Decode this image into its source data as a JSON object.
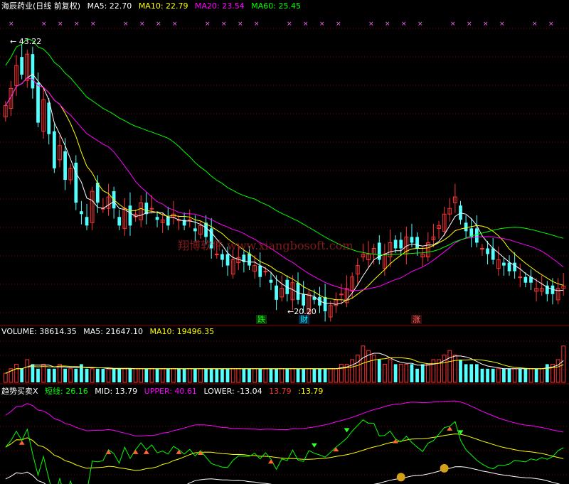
{
  "price_panel": {
    "stock": "海辰药业(日线 前复权)",
    "ma_labels": [
      {
        "label": "MA5: 22.70",
        "color": "#ffffff"
      },
      {
        "label": "MA10: 22.79",
        "color": "#ffff00"
      },
      {
        "label": "MA20: 23.54",
        "color": "#ff00ff"
      },
      {
        "label": "MA60: 25.45",
        "color": "#00ff00"
      }
    ],
    "high_note": "← 43.22",
    "low_note": "←20.20",
    "badges": [
      {
        "text": "跌",
        "color": "#00ff00",
        "bg": "#0c3a0c"
      },
      {
        "text": "财",
        "color": "#00ffff",
        "bg": "#0a2a4a"
      },
      {
        "text": "涨",
        "color": "#ff6666",
        "bg": "#3a0c0c"
      }
    ],
    "watermark": "翔博软件 www.xiangbosoft.com"
  },
  "volume_panel": {
    "labels": [
      {
        "label": "VOLUME: 38614.35",
        "color": "#ffffff"
      },
      {
        "label": "MA5: 21647.10",
        "color": "#ffffff"
      },
      {
        "label": "MA10: 19496.35",
        "color": "#ffff00"
      }
    ]
  },
  "indicator_panel": {
    "labels": [
      {
        "label": "趋势买卖X",
        "color": "#ffffff"
      },
      {
        "label": "短线: 26.16",
        "color": "#00ff00"
      },
      {
        "label": "MID: 13.79",
        "color": "#ffffff"
      },
      {
        "label": "UPPER: 40.61",
        "color": "#ff00ff"
      },
      {
        "label": "LOWER: -13.04",
        "color": "#ffffff"
      },
      {
        "label": "13.79",
        "color": "#ff3333"
      },
      {
        "label": ":13.79",
        "color": "#ffff00"
      }
    ]
  },
  "colors": {
    "up": "#ff3333",
    "down": "#54ffff",
    "ma5": "#ffffff",
    "ma10": "#ffff00",
    "ma20": "#ff00ff",
    "ma60": "#00ff00",
    "grid": "#8b0000"
  },
  "chart_data": {
    "type": "candlestick",
    "price_axis": {
      "min": 19.5,
      "max": 45.0
    },
    "high_value": 43.22,
    "low_value": 20.2,
    "close_prices": [
      38.5,
      40.0,
      42.0,
      41.2,
      43.0,
      40.0,
      37.0,
      39.0,
      36.0,
      33.0,
      35.0,
      32.0,
      33.0,
      30.0,
      29.0,
      28.0,
      31.0,
      30.0,
      29.5,
      30.5,
      29.5,
      28.0,
      29.5,
      28.0,
      29.0,
      30.0,
      29.0,
      29.5,
      28.5,
      28.5,
      28.0,
      29.0,
      28.5,
      28.0,
      28.5,
      27.5,
      28.0,
      27.0,
      26.0,
      25.5,
      25.0,
      24.5,
      25.0,
      25.2,
      24.8,
      24.5,
      24.5,
      23.5,
      24.0,
      23.0,
      21.5,
      22.5,
      22.0,
      23.0,
      21.5,
      21.0,
      22.0,
      21.5,
      21.0,
      20.5,
      21.0,
      21.5,
      22.0,
      22.5,
      23.5,
      24.5,
      25.5,
      25.5,
      26.0,
      25.0,
      25.5,
      26.5,
      26.0,
      26.0,
      27.0,
      26.5,
      26.0,
      25.5,
      26.5,
      27.0,
      28.0,
      29.0,
      29.5,
      30.5,
      28.5,
      27.5,
      27.0,
      26.5,
      26.0,
      25.5,
      25.0,
      25.0,
      24.5,
      24.0,
      24.0,
      23.5,
      23.0,
      23.0,
      22.5,
      22.5,
      22.0,
      22.0,
      22.5,
      22.7
    ],
    "volume_relative": [
      2,
      3,
      4,
      3,
      5,
      4,
      3,
      4,
      3,
      3,
      4,
      3,
      3,
      3,
      4,
      3,
      3,
      3,
      3,
      3,
      3,
      3,
      3,
      3,
      3,
      3,
      3,
      3,
      3,
      3,
      3,
      3,
      3,
      3,
      3,
      3,
      3,
      3,
      3,
      3,
      3,
      3,
      3,
      3,
      3,
      3,
      3,
      3,
      3,
      3,
      3,
      3,
      3,
      3,
      3,
      3,
      3,
      3,
      3,
      3,
      3,
      3,
      4,
      4,
      5,
      6,
      8,
      7,
      6,
      5,
      4,
      5,
      4,
      4,
      4,
      4,
      3,
      4,
      4,
      5,
      5,
      6,
      7,
      6,
      5,
      4,
      4,
      4,
      3,
      3,
      3,
      3,
      3,
      3,
      3,
      3,
      3,
      3,
      3,
      3,
      4,
      4,
      5,
      8
    ],
    "indicator_axis": {
      "min": -15,
      "max": 45
    }
  }
}
